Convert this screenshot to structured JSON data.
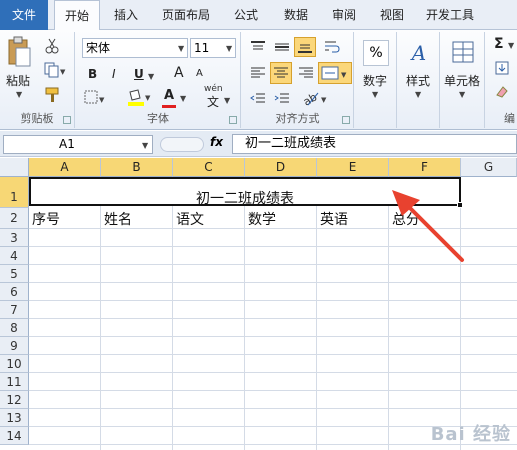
{
  "tabs": [
    "文件",
    "开始",
    "插入",
    "页面布局",
    "公式",
    "数据",
    "审阅",
    "视图",
    "开发工具"
  ],
  "clipboard": {
    "paste": "粘贴",
    "group": "剪贴板"
  },
  "font": {
    "name": "宋体",
    "size": "11",
    "group": "字体",
    "bold": "B",
    "italic": "I",
    "underline": "U",
    "grow": "A",
    "shrink": "A",
    "color_letter": "A",
    "wen": "wén",
    "wen_char": "文"
  },
  "alignment": {
    "group": "对齐方式"
  },
  "number": {
    "label": "数字",
    "symbol": "%"
  },
  "style": {
    "label": "样式",
    "symbol": "A"
  },
  "cells": {
    "label": "单元格"
  },
  "editing": {
    "sigma": "Σ",
    "partial": "编"
  },
  "formula_bar": {
    "name_box": "A1",
    "fx": "fx",
    "value": "初一二班成绩表"
  },
  "columns": [
    "A",
    "B",
    "C",
    "D",
    "E",
    "F",
    "G"
  ],
  "rows": [
    "1",
    "2",
    "3",
    "4",
    "5",
    "6",
    "7",
    "8",
    "9",
    "10",
    "11",
    "12",
    "13",
    "14"
  ],
  "sheet": {
    "title": "初一二班成绩表",
    "headers": [
      "序号",
      "姓名",
      "语文",
      "数学",
      "英语",
      "总分"
    ]
  },
  "colors": {
    "file_tab": "#2f6fb9",
    "selected_header": "#f7d775",
    "arrow": "#e8422f"
  },
  "watermark": "Bai 经验"
}
